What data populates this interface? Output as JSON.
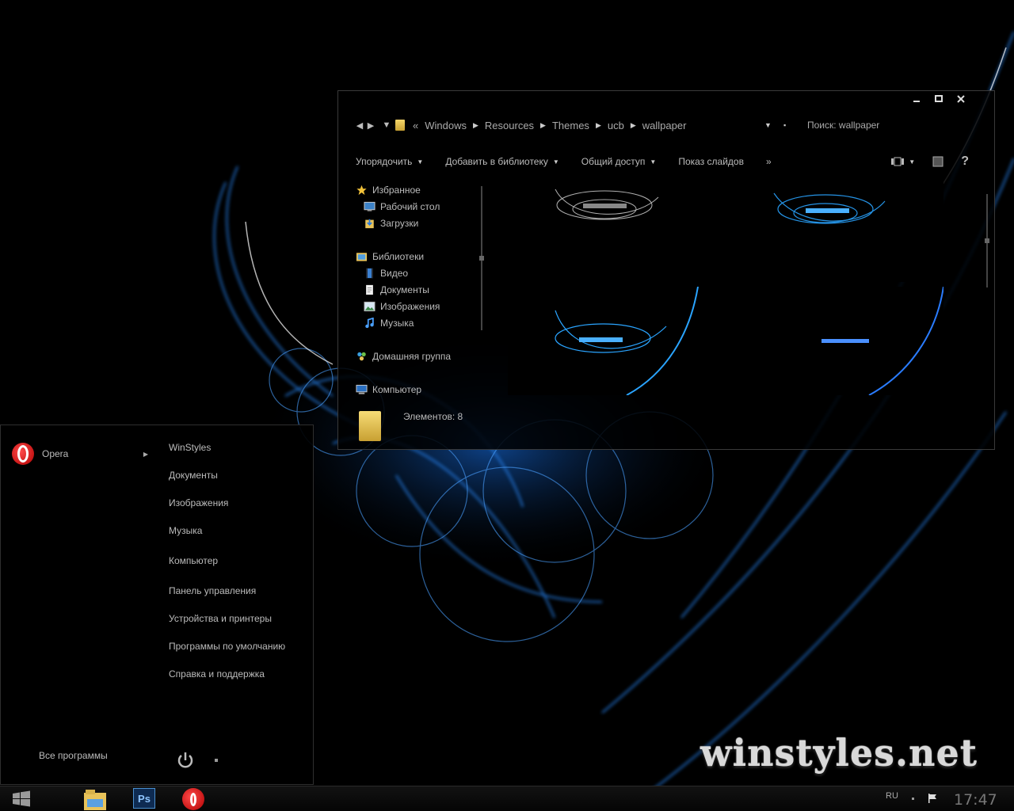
{
  "explorer": {
    "breadcrumb": [
      "Windows",
      "Resources",
      "Themes",
      "ucb",
      "wallpaper"
    ],
    "breadcrumb_prefix": "«",
    "search_placeholder": "Поиск: wallpaper",
    "toolbar": {
      "organize": "Упорядочить",
      "add_library": "Добавить в библиотеку",
      "share": "Общий доступ",
      "slideshow": "Показ слайдов",
      "more": "»",
      "help": "?"
    },
    "nav": {
      "favorites": "Избранное",
      "desktop": "Рабочий стол",
      "downloads": "Загрузки",
      "libraries": "Библиотеки",
      "video": "Видео",
      "documents": "Документы",
      "images": "Изображения",
      "music": "Музыка",
      "homegroup": "Домашняя группа",
      "computer": "Компьютер"
    },
    "status_text": "Элементов: 8"
  },
  "start_menu": {
    "pinned_app": "Opera",
    "links": [
      "WinStyles",
      "Документы",
      "Изображения",
      "Музыка",
      "Компьютер",
      "Панель управления",
      "Устройства и принтеры",
      "Программы по умолчанию",
      "Справка и поддержка"
    ],
    "all_programs": "Все программы"
  },
  "taskbar": {
    "ps_label": "Ps",
    "lang": "RU",
    "clock": "17:47"
  },
  "watermark": "winstyles.net",
  "colors": {
    "accent_blue": "#1e90ff",
    "opera_red": "#d00000",
    "ps_blue": "#1f6fb5"
  }
}
